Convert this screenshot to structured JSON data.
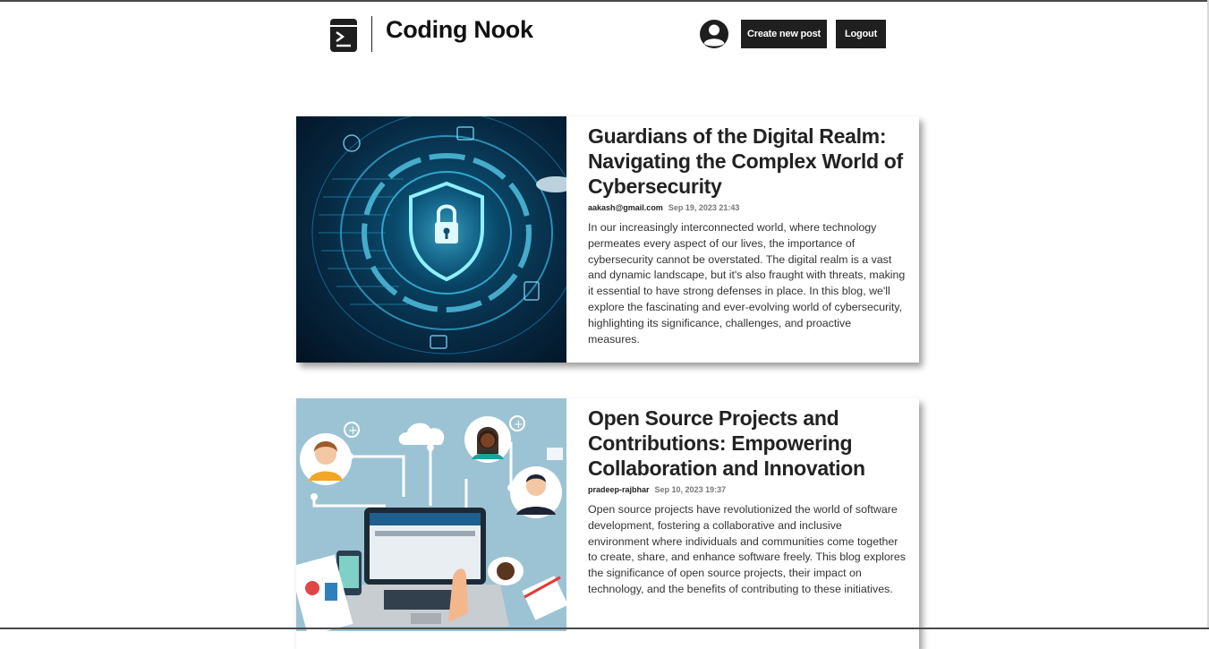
{
  "header": {
    "brand": "Coding Nook",
    "create_label": "Create new post",
    "logout_label": "Logout"
  },
  "posts": [
    {
      "title": "Guardians of the Digital Realm: Navigating the Complex World of Cybersecurity",
      "author": "aakash@gmail.com",
      "date": "Sep 19, 2023 21:43",
      "summary": "In our increasingly interconnected world, where technology permeates every aspect of our lives, the importance of cybersecurity cannot be overstated. The digital realm is a vast and dynamic landscape, but it's also fraught with threats, making it essential to have strong defenses in place. In this blog, we'll explore the fascinating and ever-evolving world of cybersecurity, highlighting its significance, challenges, and proactive measures."
    },
    {
      "title": "Open Source Projects and Contributions: Empowering Collaboration and Innovation",
      "author": "pradeep-rajbhar",
      "date": "Sep 10, 2023 19:37",
      "summary": "Open source projects have revolutionized the world of software development, fostering a collaborative and inclusive environment where individuals and communities come together to create, share, and enhance software freely. This blog explores the significance of open source projects, their impact on technology, and the benefits of contributing to these initiatives."
    }
  ]
}
